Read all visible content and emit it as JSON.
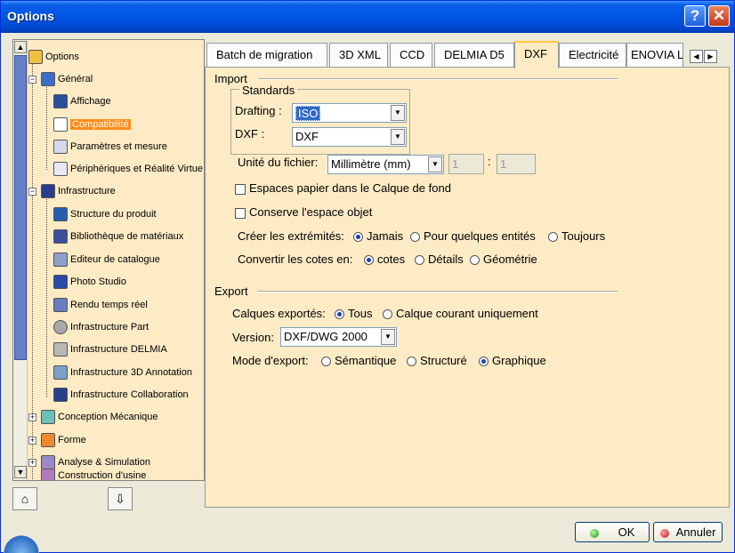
{
  "window": {
    "title": "Options"
  },
  "titlebar": {
    "help_glyph": "?",
    "close_glyph": "✕"
  },
  "tree": {
    "items": [
      {
        "label": "Options",
        "icon": "options-icon"
      },
      {
        "label": "Général",
        "icon": "general-icon"
      },
      {
        "label": "Affichage",
        "icon": "display-icon"
      },
      {
        "label": "Compatibilité",
        "icon": "compatibility-icon",
        "selected": true
      },
      {
        "label": "Paramètres et mesure",
        "icon": "parameters-icon"
      },
      {
        "label": "Périphériques et Réalité Virtue",
        "icon": "devices-vr-icon"
      },
      {
        "label": "Infrastructure",
        "icon": "infrastructure-icon"
      },
      {
        "label": "Structure du produit",
        "icon": "product-structure-icon"
      },
      {
        "label": "Bibliothèque de matériaux",
        "icon": "materials-library-icon"
      },
      {
        "label": "Editeur de catalogue",
        "icon": "catalog-editor-icon"
      },
      {
        "label": "Photo Studio",
        "icon": "photo-studio-icon"
      },
      {
        "label": "Rendu temps réel",
        "icon": "realtime-render-icon"
      },
      {
        "label": "Infrastructure Part",
        "icon": "part-infrastructure-icon"
      },
      {
        "label": "Infrastructure DELMIA",
        "icon": "delmia-infrastructure-icon"
      },
      {
        "label": "Infrastructure 3D Annotation",
        "icon": "3d-annotation-icon"
      },
      {
        "label": "Infrastructure Collaboration",
        "icon": "collaboration-icon"
      },
      {
        "label": "Conception Mécanique",
        "icon": "mechanical-design-icon"
      },
      {
        "label": "Forme",
        "icon": "shape-icon"
      },
      {
        "label": "Analyse & Simulation",
        "icon": "analysis-simulation-icon"
      },
      {
        "label": "Construction d'usine",
        "icon": "plant-construction-icon"
      }
    ],
    "expand_glyph": "+",
    "collapse_glyph": "−",
    "scroll_up_glyph": "▲",
    "scroll_down_glyph": "▼"
  },
  "tree_tools": {
    "reset_glyph": "⌂",
    "export_glyph": "⇩"
  },
  "tabs": {
    "items": [
      {
        "label": "Batch de migration"
      },
      {
        "label": "3D XML"
      },
      {
        "label": "CCD"
      },
      {
        "label": "DELMIA D5"
      },
      {
        "label": "DXF",
        "active": true
      },
      {
        "label": "Electricité"
      },
      {
        "label": "ENOVIA L"
      }
    ],
    "left_arrow_glyph": "◀",
    "right_arrow_glyph": "▶"
  },
  "dxf": {
    "import": {
      "title": "Import",
      "standards": {
        "title": "Standards",
        "drafting_label": "Drafting :",
        "drafting_value": "ISO",
        "dxf_label": "DXF :",
        "dxf_value": "DXF"
      },
      "unit_label": "Unité du fichier:",
      "unit_value": "Millimètre (mm)",
      "ratio_left": "1",
      "ratio_sep": ":",
      "ratio_right": "1",
      "paper_space_label": "Espaces papier dans le Calque de fond",
      "paper_space_checked": false,
      "object_space_label": "Conserve l'espace objet",
      "object_space_checked": false,
      "endpoints": {
        "label": "Créer les extrémités:",
        "options": [
          "Jamais",
          "Pour quelques entités",
          "Toujours"
        ],
        "selected": "Jamais"
      },
      "dimensions": {
        "label": "Convertir les cotes en:",
        "options": [
          "cotes",
          "Détails",
          "Géométrie"
        ],
        "selected": "cotes"
      }
    },
    "export": {
      "title": "Export",
      "layers": {
        "label": "Calques exportés:",
        "options": [
          "Tous",
          "Calque courant uniquement"
        ],
        "selected": "Tous"
      },
      "version_label": "Version:",
      "version_value": "DXF/DWG 2000",
      "mode": {
        "label": "Mode d'export:",
        "options": [
          "Sémantique",
          "Structuré",
          "Graphique"
        ],
        "selected": "Graphique"
      }
    }
  },
  "dialog_buttons": {
    "ok": "OK",
    "cancel": "Annuler"
  },
  "combo_arrow_glyph": "▼"
}
